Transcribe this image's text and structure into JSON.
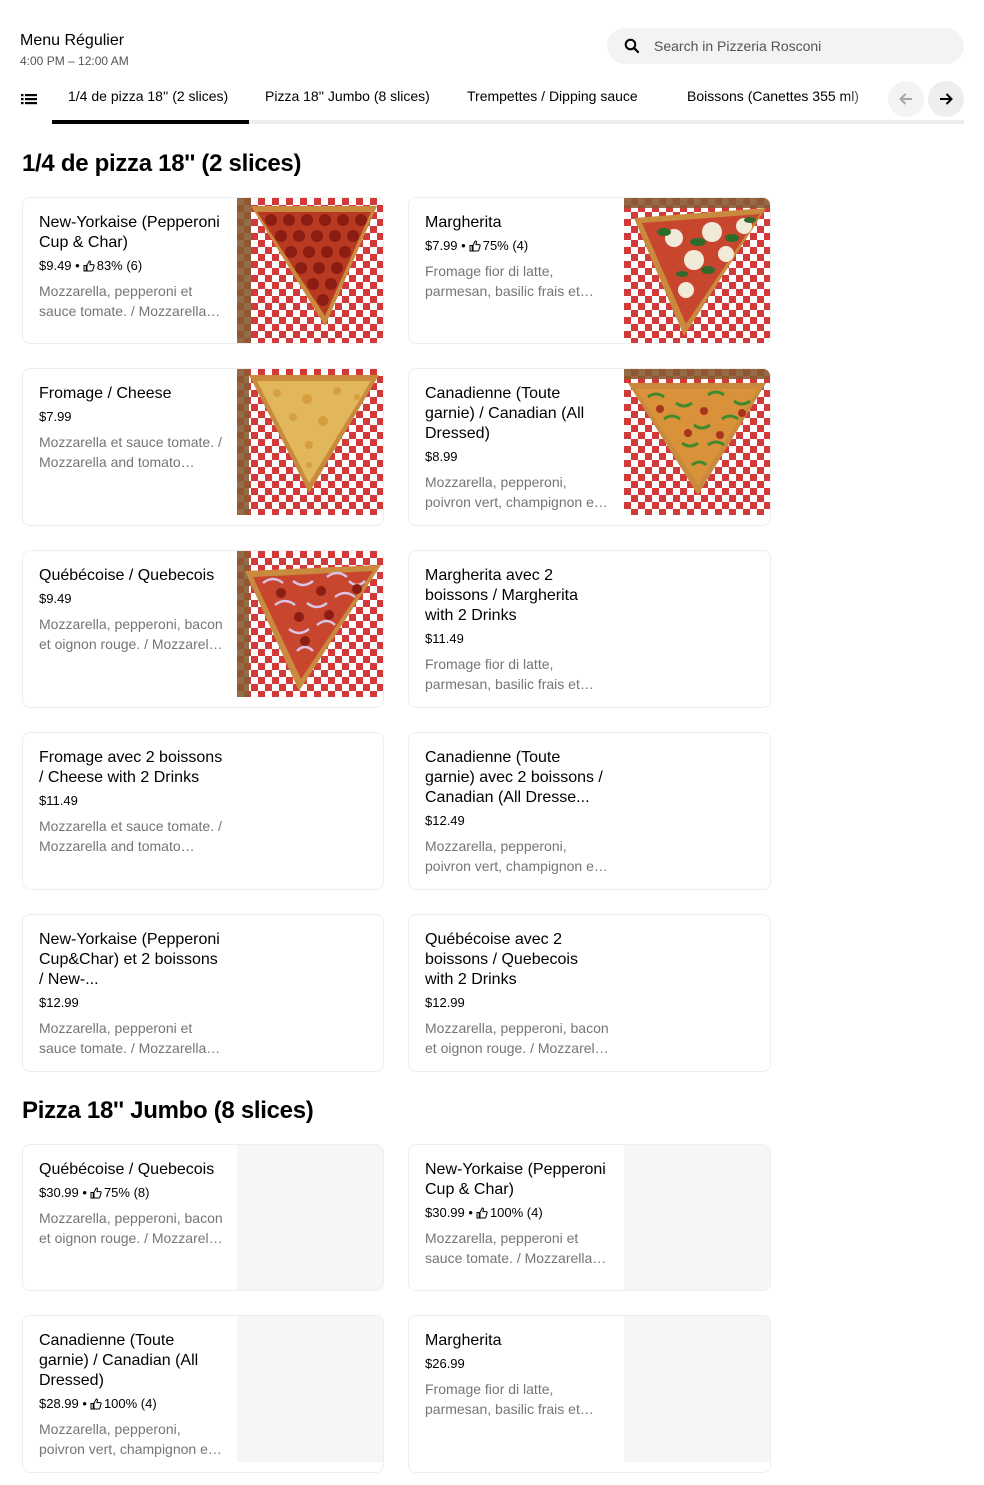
{
  "header": {
    "title": "Menu Régulier",
    "hours": "4:00 PM – 12:00 AM",
    "search_placeholder": "Search in Pizzeria Rosconi"
  },
  "tabs": [
    {
      "label": "1/4 de pizza 18'' (2 slices)",
      "active": true
    },
    {
      "label": "Pizza 18'' Jumbo (8 slices)",
      "active": false
    },
    {
      "label": "Trempettes / Dipping sauce",
      "active": false
    },
    {
      "label": "Boissons (Canettes 355 ml)",
      "active": false
    }
  ],
  "sections": [
    {
      "title": "1/4 de pizza 18'' (2 slices)",
      "items": [
        {
          "name": "New-Yorkaise (Pepperoni Cup & Char)",
          "price": "$9.49",
          "rating": "83% (6)",
          "desc": "Mozzarella, pepperoni et sauce tomate. / Mozzarella, pepperoni and tomato sauce.",
          "photo": "pepperoni-slice"
        },
        {
          "name": "Margherita",
          "price": "$7.99",
          "rating": "75% (4)",
          "desc": "Fromage fior di latte, parmesan, basilic frais et sauce tomate.",
          "photo": "margherita-slice"
        },
        {
          "name": "Fromage / Cheese",
          "price": "$7.99",
          "rating": "",
          "desc": "Mozzarella et sauce tomate. / Mozzarella and tomato sauce.",
          "photo": "cheese-slice"
        },
        {
          "name": "Canadienne (Toute garnie) / Canadian (All Dressed)",
          "price": "$8.99",
          "rating": "",
          "desc": "Mozzarella, pepperoni, poivron vert, champignon et sauce tomate.",
          "photo": "canadian-slice"
        },
        {
          "name": "Québécoise / Quebecois",
          "price": "$9.49",
          "rating": "",
          "desc": "Mozzarella, pepperoni, bacon et oignon rouge. / Mozzarella, pepperoni, bacon and red onion.",
          "photo": "quebecois-slice"
        },
        {
          "name": "Margherita avec 2 boissons / Margherita with 2 Drinks",
          "price": "$11.49",
          "rating": "",
          "desc": "Fromage fior di latte, parmesan, basilic frais et sauce tomate.",
          "photo": ""
        },
        {
          "name": "Fromage avec 2 boissons / Cheese with 2 Drinks",
          "price": "$11.49",
          "rating": "",
          "desc": "Mozzarella et sauce tomate. / Mozzarella and tomato sauce.",
          "photo": ""
        },
        {
          "name": "Canadienne (Toute garnie) avec 2 boissons / Canadian (All Dresse...",
          "price": "$12.49",
          "rating": "",
          "desc": "Mozzarella, pepperoni, poivron vert, champignon et sauce tomate.",
          "photo": ""
        },
        {
          "name": "New-Yorkaise (Pepperoni Cup&Char) et 2 boissons / New-...",
          "price": "$12.99",
          "rating": "",
          "desc": "Mozzarella, pepperoni et sauce tomate. / Mozzarella, pepperoni and tomato sauce.",
          "photo": ""
        },
        {
          "name": "Québécoise avec 2 boissons / Quebecois with  2 Drinks",
          "price": "$12.99",
          "rating": "",
          "desc": "Mozzarella, pepperoni, bacon et oignon rouge. / Mozzarella, pepperoni, bacon and red onion.",
          "photo": ""
        }
      ]
    },
    {
      "title": "Pizza 18'' Jumbo (8 slices)",
      "items": [
        {
          "name": "Québécoise / Quebecois",
          "price": "$30.99",
          "rating": "75% (8)",
          "desc": "Mozzarella, pepperoni, bacon et oignon rouge. / Mozzarella, pepperoni, bacon and red onion.",
          "photo": "blank"
        },
        {
          "name": "New-Yorkaise (Pepperoni Cup & Char)",
          "price": "$30.99",
          "rating": "100% (4)",
          "desc": "Mozzarella, pepperoni et sauce tomate. / Mozzarella, pepperoni and tomato sauce.",
          "photo": "blank"
        },
        {
          "name": "Canadienne (Toute garnie) / Canadian (All Dressed)",
          "price": "$28.99",
          "rating": "100% (4)",
          "desc": "Mozzarella, pepperoni, poivron vert, champignon et sauce tomate.",
          "photo": "blank"
        },
        {
          "name": "Margherita",
          "price": "$26.99",
          "rating": "",
          "desc": "Fromage fior di latte, parmesan, basilic frais et sauce tomate.",
          "photo": "blank"
        }
      ]
    }
  ]
}
